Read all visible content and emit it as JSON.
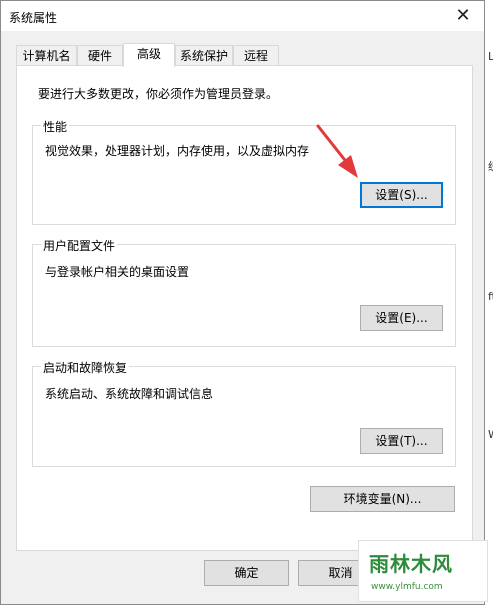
{
  "window": {
    "title": "系统属性",
    "close_glyph": "✕"
  },
  "tabs": [
    {
      "label": "计算机名",
      "active": false
    },
    {
      "label": "硬件",
      "active": false
    },
    {
      "label": "高级",
      "active": true
    },
    {
      "label": "系统保护",
      "active": false
    },
    {
      "label": "远程",
      "active": false
    }
  ],
  "notice": "要进行大多数更改，你必须作为管理员登录。",
  "groups": {
    "performance": {
      "title": "性能",
      "description": "视觉效果，处理器计划，内存使用，以及虚拟内存",
      "button": "设置(S)..."
    },
    "profile": {
      "title": "用户配置文件",
      "description": "与登录帐户相关的桌面设置",
      "button": "设置(E)..."
    },
    "startup": {
      "title": "启动和故障恢复",
      "description": "系统启动、系统故障和调试信息",
      "button": "设置(T)..."
    }
  },
  "env_button": "环境变量(N)...",
  "footer": {
    "ok": "确定",
    "cancel": "取消"
  },
  "background_fragments": [
    "L",
    "统",
    "ft",
    "W"
  ],
  "watermark": {
    "text": "雨林木风",
    "url": "www.ylmfu.com"
  },
  "colors": {
    "focus_border": "#0078d7",
    "arrow": "#e4393c",
    "watermark_green": "#2e8b3b"
  }
}
